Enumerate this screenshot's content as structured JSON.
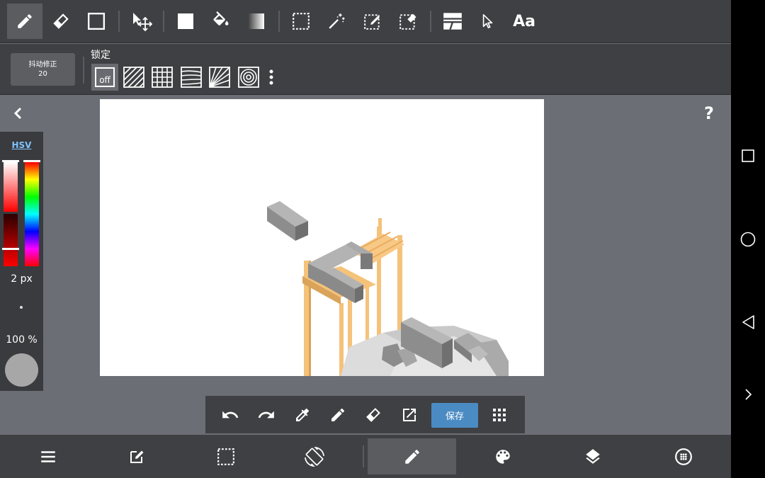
{
  "toolbar": {
    "tools": [
      {
        "name": "pen-tool",
        "icon": "pencil-icon",
        "active": true
      },
      {
        "name": "eraser-tool",
        "icon": "eraser-icon"
      },
      {
        "name": "shape-tool",
        "icon": "square-outline-icon"
      },
      {
        "name": "move-tool",
        "icon": "move-arrows-icon"
      },
      {
        "name": "fill-rect-tool",
        "icon": "filled-square-icon"
      },
      {
        "name": "bucket-tool",
        "icon": "paint-bucket-icon"
      },
      {
        "name": "gradient-tool",
        "icon": "gradient-icon"
      },
      {
        "name": "select-rect-tool",
        "icon": "dashed-select-icon"
      },
      {
        "name": "magic-wand-tool",
        "icon": "magic-wand-icon"
      },
      {
        "name": "select-pen-tool",
        "icon": "select-pen-icon"
      },
      {
        "name": "select-eraser-tool",
        "icon": "select-eraser-icon"
      },
      {
        "name": "frame-tool",
        "icon": "frame-divide-icon"
      },
      {
        "name": "operation-tool",
        "icon": "cursor-arrow-icon"
      },
      {
        "name": "text-tool",
        "icon": "text-icon"
      }
    ],
    "text_tool_label": "Aa"
  },
  "subbar": {
    "stabilizer_label": "抖动修正",
    "stabilizer_value": "20",
    "lock_label": "锁定",
    "off_label": "off",
    "rulers": [
      "parallel-lines-icon",
      "grid-icon",
      "perspective-lines-icon",
      "radial-lines-icon",
      "concentric-circles-icon",
      "more-vert-icon"
    ]
  },
  "color_panel": {
    "mode_label": "HSV",
    "brush_size": "2 px",
    "opacity": "100 %",
    "current_color": "#a7a7a7"
  },
  "floatbar": {
    "buttons": [
      "undo-icon",
      "redo-icon",
      "eyedropper-icon",
      "pen-icon",
      "eraser-icon",
      "export-icon"
    ],
    "save_label": "保存",
    "grid_icon": "apps-grid-icon"
  },
  "bottombar": {
    "buttons": [
      "menu-icon",
      "edit-icon",
      "selection-icon",
      "rotate-screen-icon",
      "pencil-icon",
      "palette-icon",
      "layers-icon",
      "material-icon"
    ],
    "active_index": 4
  },
  "colors": {
    "toolbar_bg": "#3f4043",
    "workspace_bg": "#6b6e74",
    "save_button": "#4b8bc3",
    "wood": "#f5c27a",
    "stone": "#9e9e9e"
  }
}
